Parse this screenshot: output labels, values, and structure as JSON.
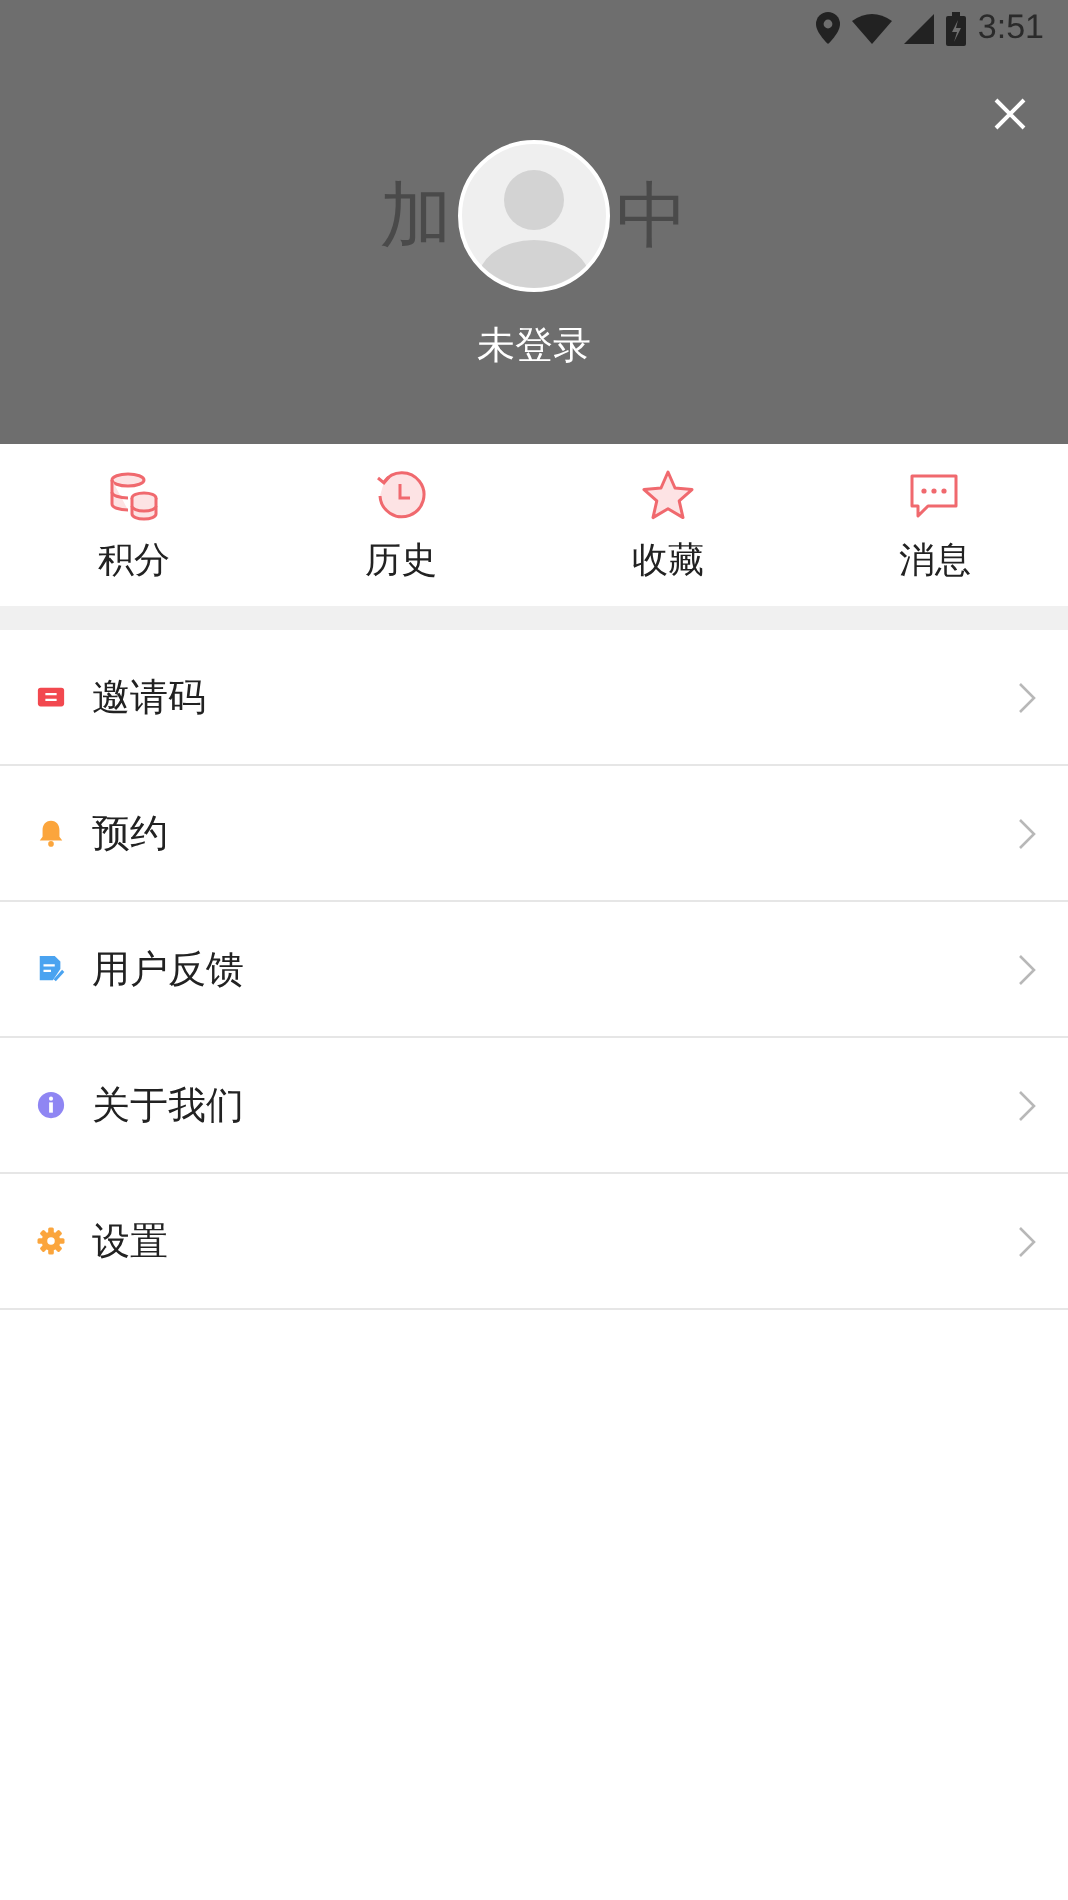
{
  "status_bar": {
    "time": "3:51"
  },
  "header": {
    "loading_text_left": "加",
    "loading_text_right": "中",
    "login_status": "未登录"
  },
  "shortcuts": [
    {
      "kind": "points",
      "label": "积分"
    },
    {
      "kind": "history",
      "label": "历史"
    },
    {
      "kind": "favorites",
      "label": "收藏"
    },
    {
      "kind": "messages",
      "label": "消息"
    }
  ],
  "menu": [
    {
      "kind": "invite",
      "label": "邀请码"
    },
    {
      "kind": "booking",
      "label": "预约"
    },
    {
      "kind": "feedback",
      "label": "用户反馈"
    },
    {
      "kind": "about",
      "label": "关于我们"
    },
    {
      "kind": "settings",
      "label": "设置"
    }
  ]
}
